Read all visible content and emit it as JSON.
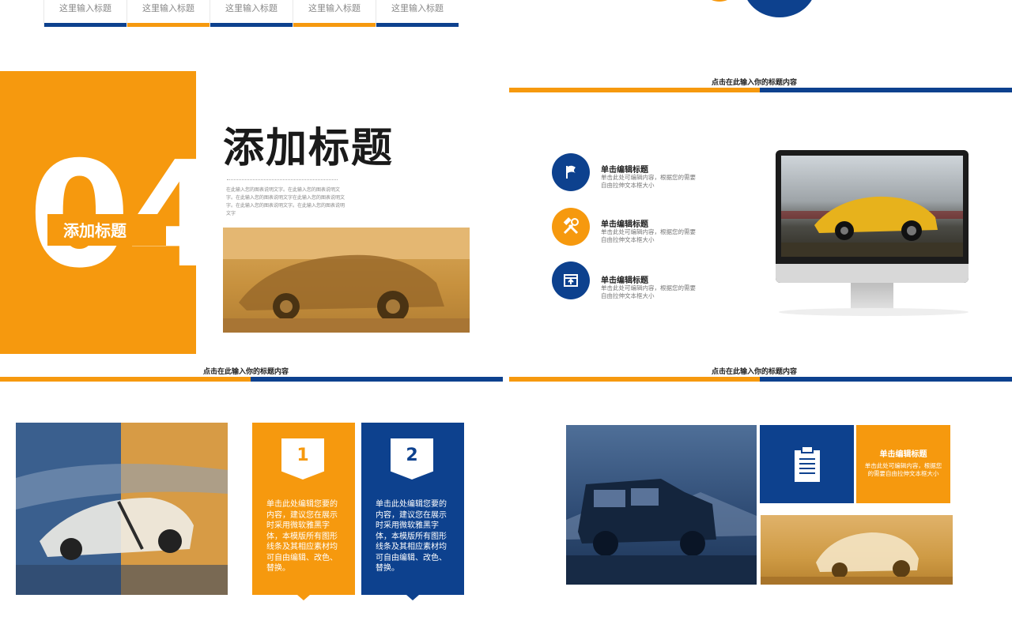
{
  "top_tabs": [
    "这里输入标题",
    "这里输入标题",
    "这里输入标题",
    "这里输入标题",
    "这里输入标题"
  ],
  "slide_titles": {
    "top_right": "点击在此输入你的标题内容",
    "mid_left": "点击在此输入你的标题内容",
    "mid_right": "点击在此输入你的标题内容"
  },
  "section": {
    "number": "04",
    "label": "添加标题",
    "heading": "添加标题",
    "paragraph": "在此输入您的图表说明文字。在此输入您的图表说明文字。在此输入您的图表说明文字在此输入您的图表说明文字。在此输入您的图表说明文字。在此输入您的图表说明文字"
  },
  "features": [
    {
      "icon": "flag-icon",
      "title": "单击编辑标题",
      "desc": "单击此处可编辑内容，根据您的需要自由拉伸文本框大小"
    },
    {
      "icon": "tools-icon",
      "title": "单击编辑标题",
      "desc": "单击此处可编辑内容，根据您的需要自由拉伸文本框大小"
    },
    {
      "icon": "upload-window-icon",
      "title": "单击编辑标题",
      "desc": "单击此处可编辑内容，根据您的需要自由拉伸文本框大小"
    }
  ],
  "cards": [
    {
      "num": "1",
      "text": "单击此处编辑您要的内容，建议您在展示时采用微软雅黑字体，本模版所有图形线条及其相应素材均可自由编辑、改色、替换。"
    },
    {
      "num": "2",
      "text": "单击此处编辑您要的内容，建议您在展示时采用微软雅黑字体，本模版所有图形线条及其相应素材均可自由编辑、改色、替换。"
    }
  ],
  "info_box": {
    "title": "单击编辑标题",
    "desc": "单击此处可编辑内容，根据您的需要自由拉伸文本框大小",
    "icon": "clipboard-icon"
  },
  "colors": {
    "orange": "#f6990e",
    "blue": "#0d418e"
  }
}
